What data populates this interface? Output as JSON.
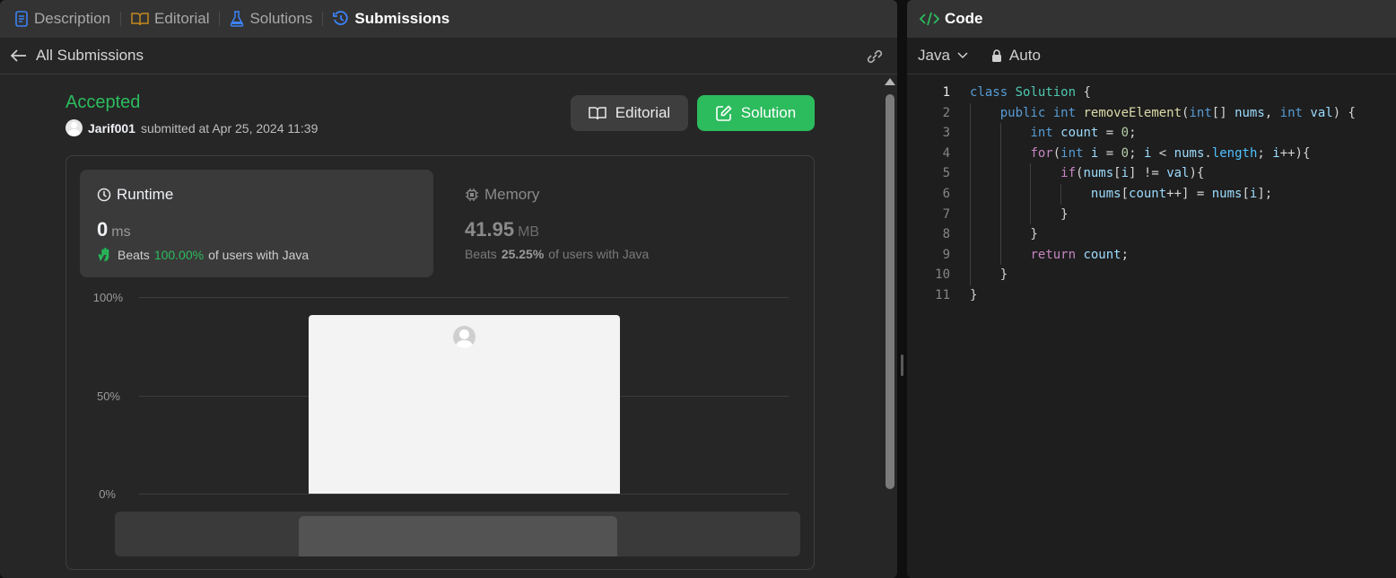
{
  "tabs": [
    {
      "label": "Description",
      "icon": "description-icon",
      "color": "#3b82f6"
    },
    {
      "label": "Editorial",
      "icon": "book-icon",
      "color": "#c48a1e"
    },
    {
      "label": "Solutions",
      "icon": "flask-icon",
      "color": "#3b82f6"
    },
    {
      "label": "Submissions",
      "icon": "history-icon",
      "color": "#3b82f6",
      "active": true
    }
  ],
  "back_label": "All Submissions",
  "submission": {
    "status": "Accepted",
    "user": "Jarif001",
    "submitted_text": "submitted at Apr 25, 2024 11:39"
  },
  "buttons": {
    "editorial": "Editorial",
    "solution": "Solution"
  },
  "runtime": {
    "title": "Runtime",
    "value": "0",
    "unit": "ms",
    "beats_label": "Beats",
    "beats_pct": "100.00%",
    "beats_suffix": "of users with Java"
  },
  "memory": {
    "title": "Memory",
    "value": "41.95",
    "unit": "MB",
    "beats_label": "Beats",
    "beats_pct": "25.25%",
    "beats_suffix": "of users with Java"
  },
  "chart_data": {
    "type": "bar",
    "yticks": [
      "100%",
      "50%",
      "0%"
    ],
    "ylim": [
      0,
      100
    ],
    "values": [
      91
    ]
  },
  "code_panel": {
    "title": "Code",
    "language": "Java",
    "mode": "Auto"
  },
  "code_lines": [
    "class Solution {",
    "    public int removeElement(int[] nums, int val) {",
    "        int count = 0;",
    "        for(int i = 0; i < nums.length; i++){",
    "            if(nums[i] != val){",
    "                nums[count++] = nums[i];",
    "            }",
    "        }",
    "        return count;",
    "    }",
    "}"
  ],
  "line_numbers": [
    "1",
    "2",
    "3",
    "4",
    "5",
    "6",
    "7",
    "8",
    "9",
    "10",
    "11"
  ],
  "colors": {
    "accent_green": "#2cbb5d",
    "panel_bg": "#262626",
    "editor_bg": "#1e1e1e"
  }
}
